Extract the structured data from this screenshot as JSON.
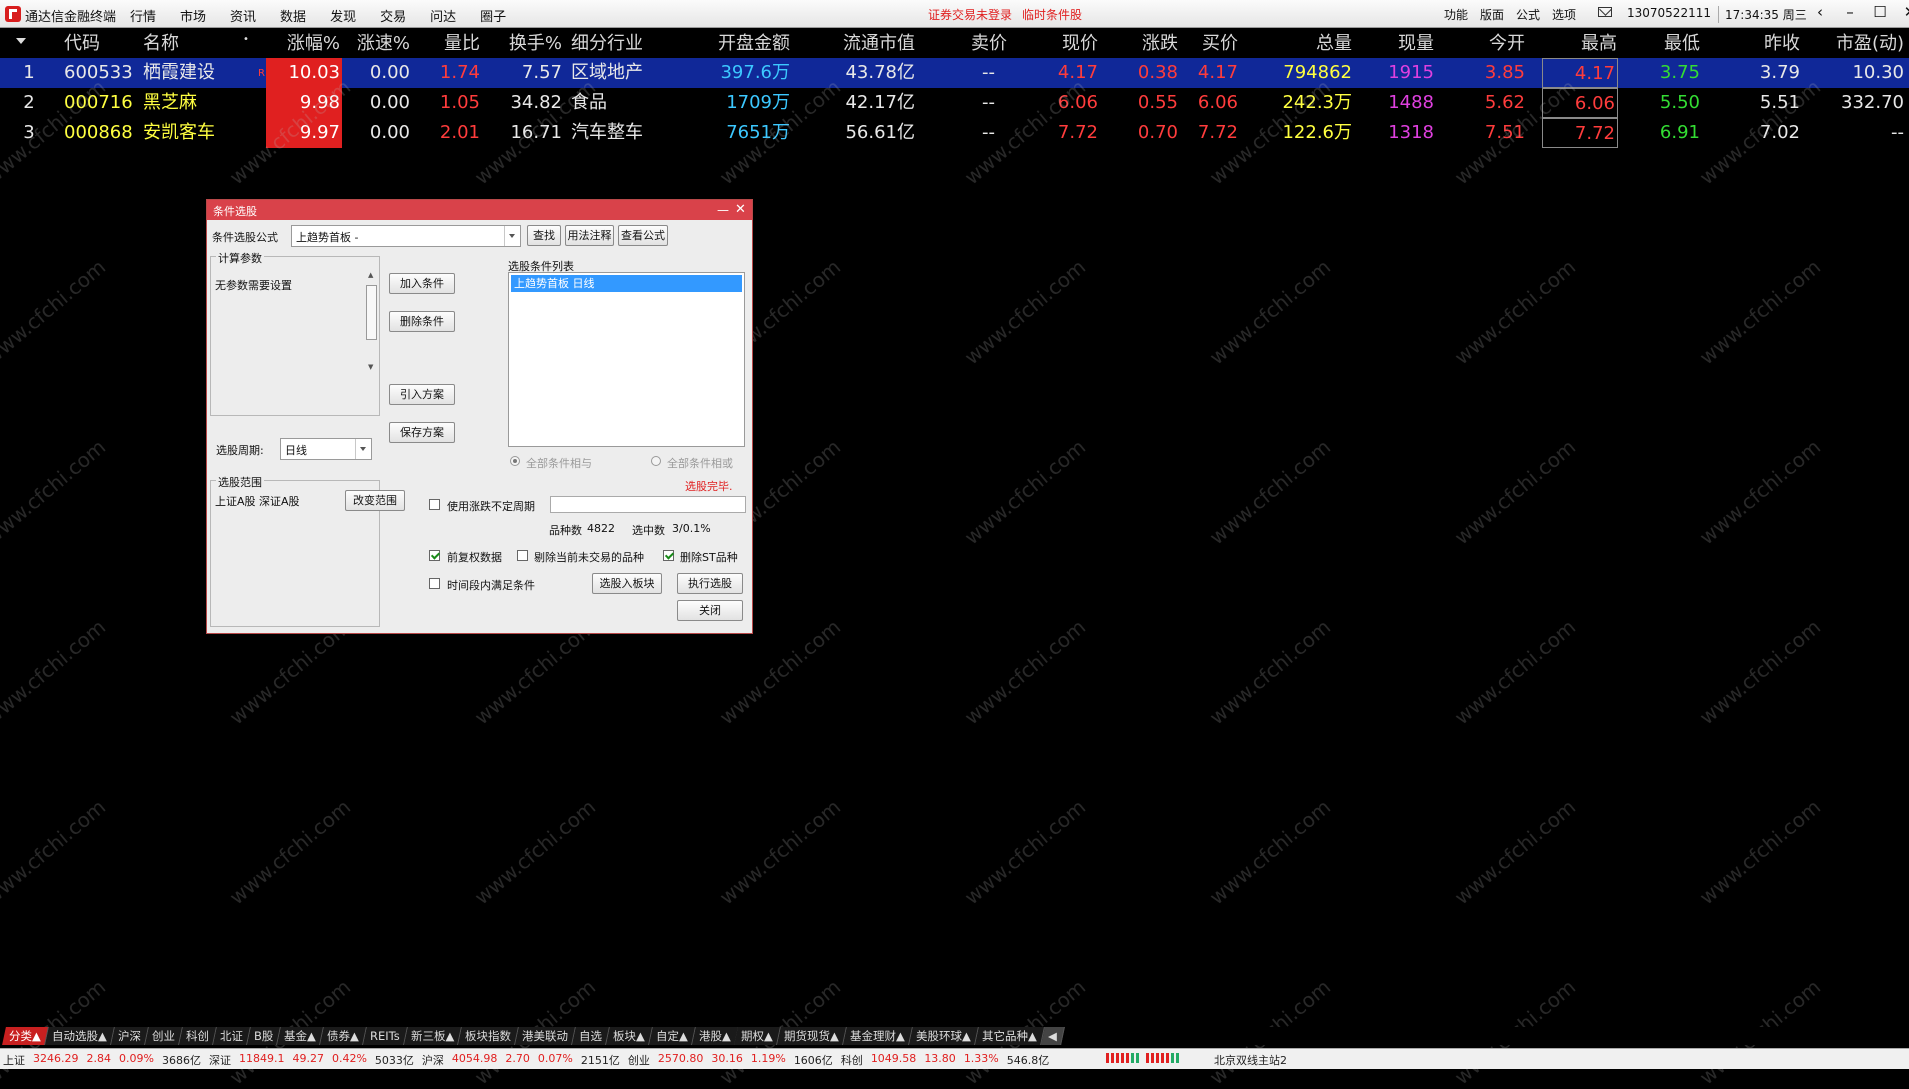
{
  "topbar": {
    "app_title": "通达信金融终端",
    "menu": [
      "行情",
      "市场",
      "资讯",
      "数据",
      "发现",
      "交易",
      "问达",
      "圈子"
    ],
    "notices": [
      "证券交易未登录",
      "临时条件股"
    ],
    "right_menu": [
      "功能",
      "版面",
      "公式",
      "选项"
    ],
    "phone": "13070522111",
    "clock": "17:34:35 周三"
  },
  "table": {
    "headers": [
      "代码",
      "名称",
      "涨幅%",
      "涨速%",
      "量比",
      "换手%",
      "细分行业",
      "开盘金额",
      "流通市值",
      "卖价",
      "现价",
      "涨跌",
      "买价",
      "总量",
      "现量",
      "今开",
      "最高",
      "最低",
      "昨收",
      "市盈(动)"
    ],
    "rows": [
      {
        "idx": "1",
        "code": "600533",
        "name": "栖霞建设",
        "mark": "R",
        "pct": "10.03",
        "speed": "0.00",
        "vol_ratio": "1.74",
        "turnover": "7.57",
        "industry": "区域地产",
        "open_amt": "397.6万",
        "float_mv": "43.78亿",
        "ask": "--",
        "price": "4.17",
        "change": "0.38",
        "bid": "4.17",
        "total_vol": "794862",
        "cur_vol": "1915",
        "open": "3.85",
        "high": "4.17",
        "low": "3.75",
        "prev_close": "3.79",
        "pe": "10.30"
      },
      {
        "idx": "2",
        "code": "000716",
        "name": "黑芝麻",
        "mark": "",
        "pct": "9.98",
        "speed": "0.00",
        "vol_ratio": "1.05",
        "turnover": "34.82",
        "industry": "食品",
        "open_amt": "1709万",
        "float_mv": "42.17亿",
        "ask": "--",
        "price": "6.06",
        "change": "0.55",
        "bid": "6.06",
        "total_vol": "242.3万",
        "cur_vol": "1488",
        "open": "5.62",
        "high": "6.06",
        "low": "5.50",
        "prev_close": "5.51",
        "pe": "332.70"
      },
      {
        "idx": "3",
        "code": "000868",
        "name": "安凯客车",
        "mark": "",
        "pct": "9.97",
        "speed": "0.00",
        "vol_ratio": "2.01",
        "turnover": "16.71",
        "industry": "汽车整车",
        "open_amt": "7651万",
        "float_mv": "56.61亿",
        "ask": "--",
        "price": "7.72",
        "change": "0.70",
        "bid": "7.72",
        "total_vol": "122.6万",
        "cur_vol": "1318",
        "open": "7.51",
        "high": "7.72",
        "low": "6.91",
        "prev_close": "7.02",
        "pe": "--"
      }
    ]
  },
  "dialog": {
    "title": "条件选股",
    "formula_label": "条件选股公式",
    "formula_value": "上趋势首板  -",
    "btn_find": "查找",
    "btn_usage": "用法注释",
    "btn_view": "查看公式",
    "params_group": "计算参数",
    "params_text": "无参数需要设置",
    "period_label": "选股周期:",
    "period_value": "日线",
    "range_group": "选股范围",
    "range_text": "上证A股 深证A股",
    "btn_change_range": "改变范围",
    "btn_add": "加入条件",
    "btn_delete": "删除条件",
    "btn_import": "引入方案",
    "btn_save": "保存方案",
    "list_label": "选股条件列表",
    "list_items": [
      "上趋势首板  日线"
    ],
    "radio_and": "全部条件相与",
    "radio_or": "全部条件相或",
    "done_text": "选股完毕.",
    "chk_variable_period": "使用涨跌不定周期",
    "count_label": "品种数",
    "count_value": "4822",
    "selected_label": "选中数",
    "selected_value": "3/0.1%",
    "chk_adjust": "前复权数据",
    "chk_exclude_untraded": "剔除当前未交易的品种",
    "chk_exclude_st": "删除ST品种",
    "chk_period_cond": "时间段内满足条件",
    "btn_to_block": "选股入板块",
    "btn_execute": "执行选股",
    "btn_close": "关闭"
  },
  "tabs": [
    "分类▲",
    "自动选股▲",
    "沪深",
    "创业",
    "科创",
    "北证",
    "B股",
    "基金▲",
    "债券▲",
    "REITs",
    "新三板▲",
    "板块指数",
    "港美联动",
    "自选",
    "板块▲",
    "自定▲",
    "港股▲",
    "期权▲",
    "期货现货▲",
    "基金理财▲",
    "美股环球▲",
    "其它品种▲",
    "◀"
  ],
  "status": {
    "items": [
      {
        "t": "上证",
        "c": "dk"
      },
      {
        "t": "3246.29",
        "c": "red"
      },
      {
        "t": "2.84",
        "c": "red"
      },
      {
        "t": "0.09%",
        "c": "red"
      },
      {
        "t": "3686亿",
        "c": "dk"
      },
      {
        "t": "深证",
        "c": "dk"
      },
      {
        "t": "11849.1",
        "c": "red"
      },
      {
        "t": "49.27",
        "c": "red"
      },
      {
        "t": "0.42%",
        "c": "red"
      },
      {
        "t": "5033亿",
        "c": "dk"
      },
      {
        "t": "沪深",
        "c": "dk"
      },
      {
        "t": "4054.98",
        "c": "red"
      },
      {
        "t": "2.70",
        "c": "red"
      },
      {
        "t": "0.07%",
        "c": "red"
      },
      {
        "t": "2151亿",
        "c": "dk"
      },
      {
        "t": "创业",
        "c": "dk"
      },
      {
        "t": "2570.80",
        "c": "red"
      },
      {
        "t": "30.16",
        "c": "red"
      },
      {
        "t": "1.19%",
        "c": "red"
      },
      {
        "t": "1606亿",
        "c": "dk"
      },
      {
        "t": "科创",
        "c": "dk"
      },
      {
        "t": "1049.58",
        "c": "red"
      },
      {
        "t": "13.80",
        "c": "red"
      },
      {
        "t": "1.33%",
        "c": "red"
      },
      {
        "t": "546.8亿",
        "c": "dk"
      }
    ],
    "server": "北京双线主站2"
  },
  "watermark": "www.cfchi.com",
  "colors": {
    "selected_row": "#102898",
    "up": "#ff3c3c",
    "down": "#33dd33",
    "dialog_title": "#d9424a"
  }
}
